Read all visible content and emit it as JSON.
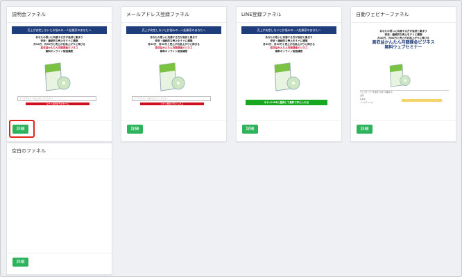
{
  "cards": [
    {
      "title": "説明会ファネル",
      "button": "詳細",
      "banner": "売上が安定しないとお悩みの一人起業家のあなたへ",
      "lines": [
        "あなたの思いに共感する方が自然と集まり",
        "安定・継続的な売上をすぐに構築",
        "月30万、月50万と売上が右肩上がりに伸びる",
        "高収益かんたん月額課金ビジネス",
        "無料オンライン勉強講座"
      ],
      "field_placeholder": "メールアドレスを入力してください",
      "cta": "今すぐ説明会予約をする"
    },
    {
      "title": "メールアドレス登録ファネル",
      "button": "詳細",
      "banner": "売上が安定しないとお悩みの一人起業家のあなたへ",
      "lines": [
        "あなたの思いに共感する方が自然と集まり",
        "安定・継続的な売上をすぐに構築",
        "月30万、月50万と売上が右肩上がりに伸びる",
        "高収益かんたん月額課金ビジネス",
        "無料オンライン勉強講座"
      ],
      "field_placeholder": "メールアドレスを入力してください",
      "cta": "今すぐ無料で手に入れる"
    },
    {
      "title": "LINE登録ファネル",
      "button": "詳細",
      "banner": "売上が安定しないとお悩みの一人起業家のあなたへ",
      "lines": [
        "あなたの思いに共感する方が自然と集まり",
        "安定・継続的な売上をすぐに構築",
        "月30万、月50万と売上が右肩上がりに伸びる",
        "高収益かんたん月額課金ビジネス",
        "無料オンライン勉強講座"
      ],
      "cta": "今すぐLINEに登録して無料で手に入れる"
    },
    {
      "title": "自動ウェビナーファネル",
      "button": "詳細",
      "lines": [
        "あなたの思いに共感する方が自然と集まり",
        "安定・継続的な売上をすぐに構築",
        "月30万、月50万と売上が右肩上がりに伸びる"
      ],
      "headline1": "高収益かんたん月額課金ビジネス",
      "headline2": "無料ウェブセミナー",
      "form_rows": [
        "ウェブセミナーを無料で今すぐ視聴する",
        "日時",
        "お名前",
        "メールアドレス"
      ]
    },
    {
      "title": "空白のファネル",
      "button": "詳細"
    }
  ],
  "colors": {
    "accent_button": "#2cb35b",
    "highlight": "#e2231a",
    "banner": "#1f3d7a"
  }
}
